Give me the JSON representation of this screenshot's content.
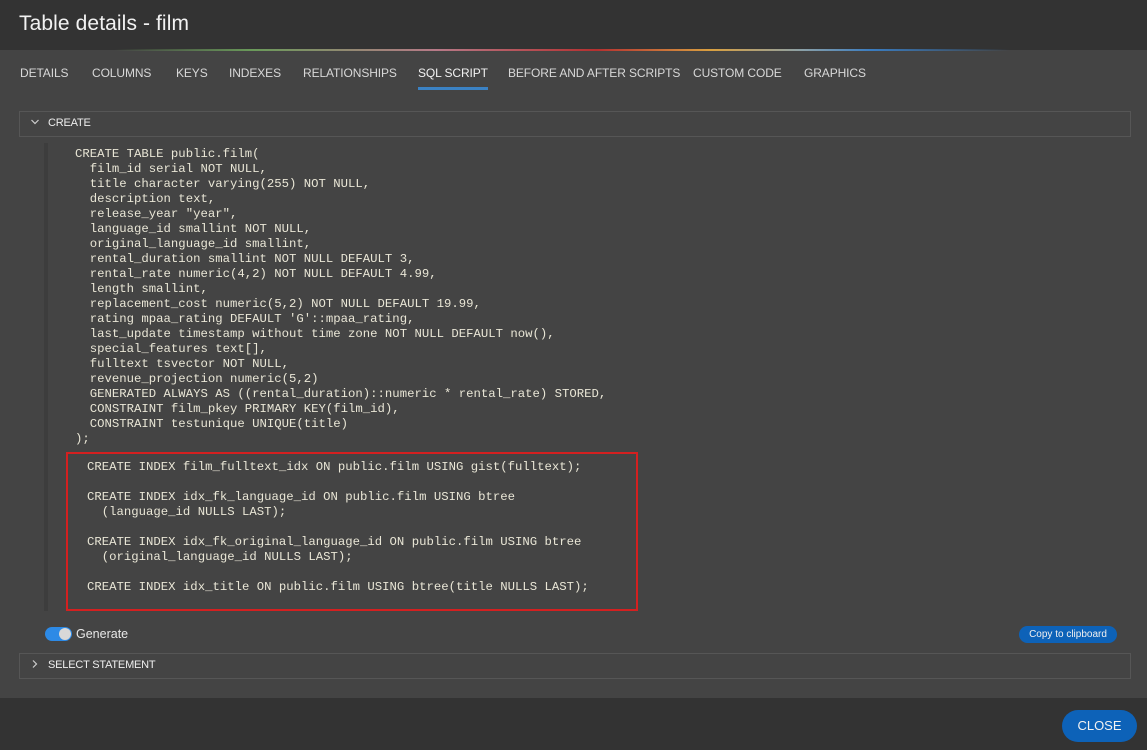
{
  "window": {
    "title": "Table details - film"
  },
  "tabs": [
    {
      "label": "DETAILS",
      "active": false
    },
    {
      "label": "COLUMNS",
      "active": false
    },
    {
      "label": "KEYS",
      "active": false
    },
    {
      "label": "INDEXES",
      "active": false
    },
    {
      "label": "RELATIONSHIPS",
      "active": false
    },
    {
      "label": "SQL SCRIPT",
      "active": true
    },
    {
      "label": "BEFORE AND AFTER SCRIPTS",
      "active": false
    },
    {
      "label": "CUSTOM CODE",
      "active": false
    },
    {
      "label": "GRAPHICS",
      "active": false
    }
  ],
  "sections": {
    "create": {
      "label": "CREATE",
      "expanded": true,
      "icon": "chevron-down-icon"
    },
    "select": {
      "label": "SELECT STATEMENT",
      "expanded": false,
      "icon": "chevron-right-icon"
    }
  },
  "sql": {
    "create_table": "CREATE TABLE public.film(\n  film_id serial NOT NULL,\n  title character varying(255) NOT NULL,\n  description text,\n  release_year \"year\",\n  language_id smallint NOT NULL,\n  original_language_id smallint,\n  rental_duration smallint NOT NULL DEFAULT 3,\n  rental_rate numeric(4,2) NOT NULL DEFAULT 4.99,\n  length smallint,\n  replacement_cost numeric(5,2) NOT NULL DEFAULT 19.99,\n  rating mpaa_rating DEFAULT 'G'::mpaa_rating,\n  last_update timestamp without time zone NOT NULL DEFAULT now(),\n  special_features text[],\n  fulltext tsvector NOT NULL,\n  revenue_projection numeric(5,2)\n  GENERATED ALWAYS AS ((rental_duration)::numeric * rental_rate) STORED,\n  CONSTRAINT film_pkey PRIMARY KEY(film_id),\n  CONSTRAINT testunique UNIQUE(title)\n);",
    "create_indexes": "CREATE INDEX film_fulltext_idx ON public.film USING gist(fulltext);\n\nCREATE INDEX idx_fk_language_id ON public.film USING btree\n  (language_id NULLS LAST);\n\nCREATE INDEX idx_fk_original_language_id ON public.film USING btree\n  (original_language_id NULLS LAST);\n\nCREATE INDEX idx_title ON public.film USING btree(title NULLS LAST);"
  },
  "generate": {
    "label": "Generate",
    "enabled": true
  },
  "buttons": {
    "copy": "Copy to clipboard",
    "close": "CLOSE"
  },
  "colors": {
    "accent": "#0d62b8",
    "tab_underline": "#3b82c4",
    "highlight_border": "#d42020",
    "toggle_on": "#2d8ae6"
  }
}
